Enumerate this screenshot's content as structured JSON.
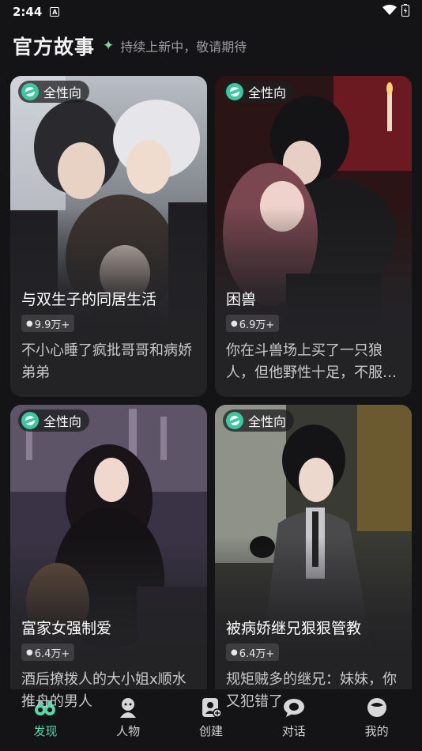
{
  "status_bar": {
    "time": "2:44",
    "notif_badge": "A"
  },
  "header": {
    "title": "官方故事",
    "sparkle_icon": "✦",
    "subtitle": "持续上新中，敬请期待"
  },
  "cards": [
    {
      "tag": "全性向",
      "title": "与双生子的同居生活",
      "views": "9.9万+",
      "desc": "不小心睡了疯批哥哥和病娇弟弟"
    },
    {
      "tag": "全性向",
      "title": "困兽",
      "views": "6.9万+",
      "desc": "你在斗兽场上买了一只狼人，但他野性十足，不服管教"
    },
    {
      "tag": "全性向",
      "title": "富家女强制爱",
      "views": "6.4万+",
      "desc": "酒后撩拨人的大小姐x顺水推舟的男人"
    },
    {
      "tag": "全性向",
      "title": "被病娇继兄狠狠管教",
      "views": "6.4万+",
      "desc": "规矩贼多的继兄：妹妹，你又犯错了"
    }
  ],
  "nav": {
    "items": [
      {
        "label": "发现",
        "icon": "binoculars-icon"
      },
      {
        "label": "人物",
        "icon": "character-icon"
      },
      {
        "label": "创建",
        "icon": "create-icon"
      },
      {
        "label": "对话",
        "icon": "chat-icon"
      },
      {
        "label": "我的",
        "icon": "profile-icon"
      }
    ],
    "active_color": "#5ad6a8"
  },
  "colors": {
    "background": "#141416",
    "card": "#232326",
    "accent": "#3ec6a0"
  }
}
